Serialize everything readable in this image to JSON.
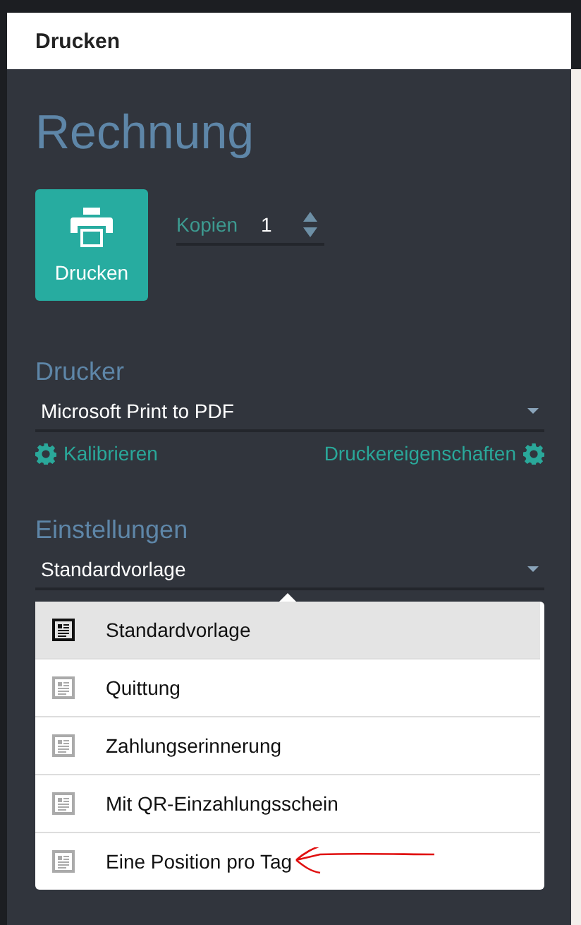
{
  "window": {
    "title": "Drucken"
  },
  "heading": "Rechnung",
  "print_button": {
    "label": "Drucken"
  },
  "copies": {
    "label": "Kopien",
    "value": "1"
  },
  "printer": {
    "label": "Drucker",
    "value": "Microsoft Print to PDF",
    "links": [
      "Kalibrieren",
      "Druckereigenschaften"
    ]
  },
  "settings": {
    "label": "Einstellungen",
    "value": "Standardvorlage",
    "expanded": true
  },
  "template_menu": [
    {
      "label": "Standardvorlage",
      "selected": true,
      "marked": false
    },
    {
      "label": "Quittung",
      "selected": false,
      "marked": false
    },
    {
      "label": "Zahlungserinnerung",
      "selected": false,
      "marked": false
    },
    {
      "label": "Mit QR-Einzahlungsschein",
      "selected": false,
      "marked": false
    },
    {
      "label": "Eine Position pro Tag",
      "selected": false,
      "marked": true
    }
  ]
}
